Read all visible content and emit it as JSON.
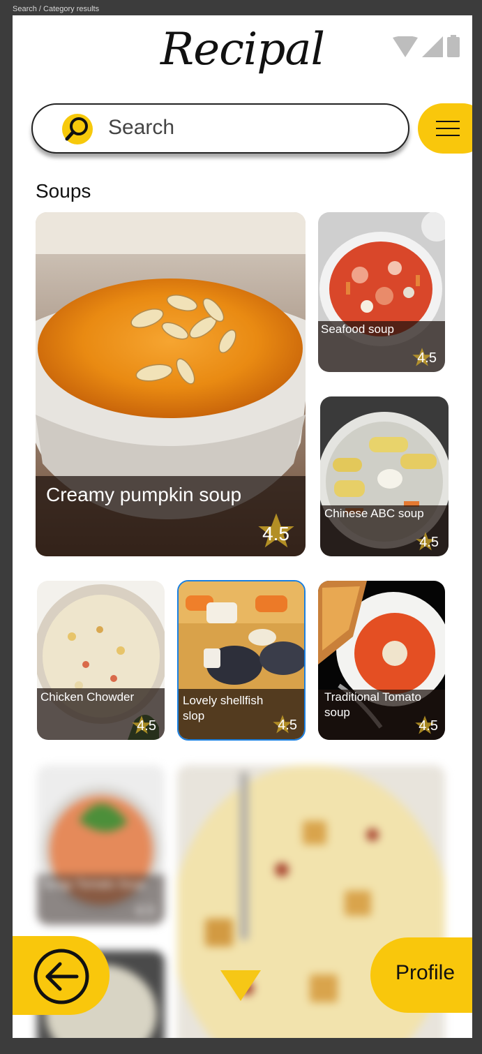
{
  "frame_label": "Search / Category results",
  "app": {
    "logo": "Recipal"
  },
  "search": {
    "placeholder": "Search"
  },
  "category": {
    "title": "Soups"
  },
  "recipes": [
    {
      "name": "Creamy pumpkin soup",
      "rating": "4.5"
    },
    {
      "name": "Seafood soup",
      "rating": "4.5"
    },
    {
      "name": "Chinese ABC soup",
      "rating": "4.5"
    },
    {
      "name": "Chicken Chowder",
      "rating": "4.5"
    },
    {
      "name": "Lovely shellfish slop",
      "rating": "4.5",
      "selected": true
    },
    {
      "name": "Traditional Tomato soup",
      "rating": "4.5"
    },
    {
      "name": "Tangy Tomato Soup",
      "rating": "4.5"
    }
  ],
  "nav": {
    "profile_label": "Profile"
  },
  "colors": {
    "accent": "#f9c70c",
    "selected_border": "#1a7fe0",
    "star": "#c9a227"
  },
  "icons": [
    "search-icon",
    "menu-icon",
    "star-icon",
    "back-arrow-icon",
    "chevron-down-icon",
    "wifi-icon",
    "signal-icon",
    "battery-icon"
  ]
}
